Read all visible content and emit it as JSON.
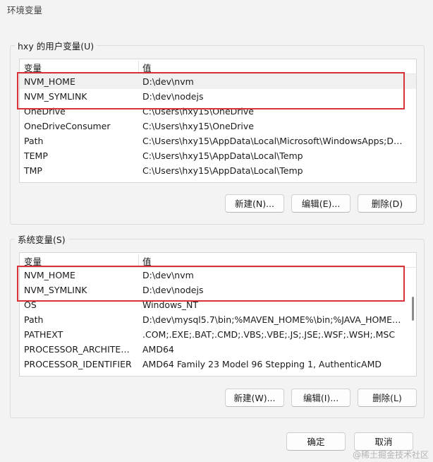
{
  "window": {
    "title": "环境变量"
  },
  "user_group": {
    "label": "hxy 的用户变量(U)",
    "col_var": "变量",
    "col_val": "值",
    "rows": [
      {
        "name": "NVM_HOME",
        "value": "D:\\dev\\nvm"
      },
      {
        "name": "NVM_SYMLINK",
        "value": "D:\\dev\\nodejs"
      },
      {
        "name": "OneDrive",
        "value": "C:\\Users\\hxy15\\OneDrive"
      },
      {
        "name": "OneDriveConsumer",
        "value": "C:\\Users\\hxy15\\OneDrive"
      },
      {
        "name": "Path",
        "value": "C:\\Users\\hxy15\\AppData\\Local\\Microsoft\\WindowsApps;D:\\d..."
      },
      {
        "name": "TEMP",
        "value": "C:\\Users\\hxy15\\AppData\\Local\\Temp"
      },
      {
        "name": "TMP",
        "value": "C:\\Users\\hxy15\\AppData\\Local\\Temp"
      }
    ],
    "new": "新建(N)...",
    "edit": "编辑(E)...",
    "delete": "删除(D)"
  },
  "system_group": {
    "label": "系统变量(S)",
    "col_var": "变量",
    "col_val": "值",
    "rows": [
      {
        "name": "NVM_HOME",
        "value": "D:\\dev\\nvm"
      },
      {
        "name": "NVM_SYMLINK",
        "value": "D:\\dev\\nodejs"
      },
      {
        "name": "OS",
        "value": "Windows_NT"
      },
      {
        "name": "Path",
        "value": "D:\\dev\\mysql5.7\\bin;%MAVEN_HOME%\\bin;%JAVA_HOME%\\..."
      },
      {
        "name": "PATHEXT",
        "value": ".COM;.EXE;.BAT;.CMD;.VBS;.VBE;.JS;.JSE;.WSF;.WSH;.MSC"
      },
      {
        "name": "PROCESSOR_ARCHITECT...",
        "value": "AMD64"
      },
      {
        "name": "PROCESSOR_IDENTIFIER",
        "value": "AMD64 Family 23 Model 96 Stepping 1, AuthenticAMD"
      }
    ],
    "new": "新建(W)...",
    "edit": "编辑(I)...",
    "delete": "删除(L)"
  },
  "footer": {
    "ok": "确定",
    "cancel": "取消"
  },
  "watermark": "@稀土掘金技术社区",
  "colors": {
    "highlight": "#d9333a"
  }
}
